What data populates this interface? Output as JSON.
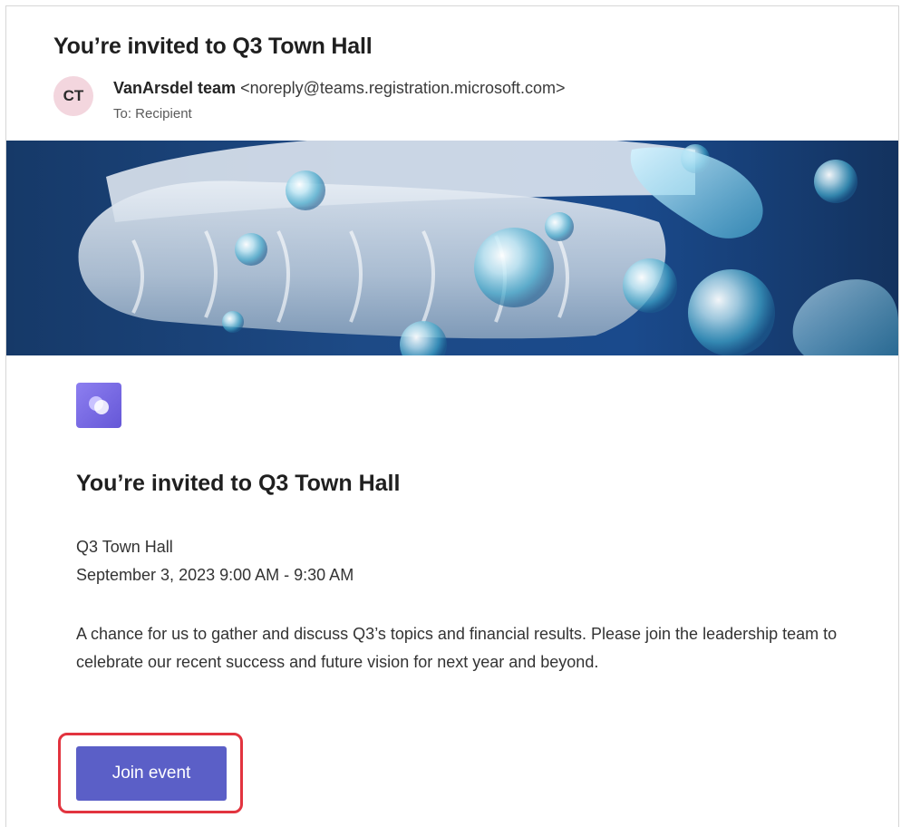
{
  "email": {
    "subject": "You’re invited to Q3 Town Hall",
    "sender": {
      "avatar_initials": "CT",
      "name": "VanArsdel team",
      "address": "<noreply@teams.registration.microsoft.com>",
      "to_line": "To: Recipient"
    }
  },
  "banner": {
    "image": "sneaker-sole-with-glass-bubbles",
    "background_color": "#1d4a86"
  },
  "event": {
    "app_icon": "teams-town-hall-icon",
    "headline": "You’re invited to Q3 Town Hall",
    "name": "Q3 Town Hall",
    "datetime": "September 3, 2023 9:00 AM - 9:30 AM",
    "description": "A chance for us to gather and discuss Q3’s topics and financial results. Please join the leadership team to celebrate our recent success and future vision for next year and beyond.",
    "join_button_label": "Join event",
    "accent_color": "#5b5fc7",
    "highlight_color": "#e2343f"
  }
}
